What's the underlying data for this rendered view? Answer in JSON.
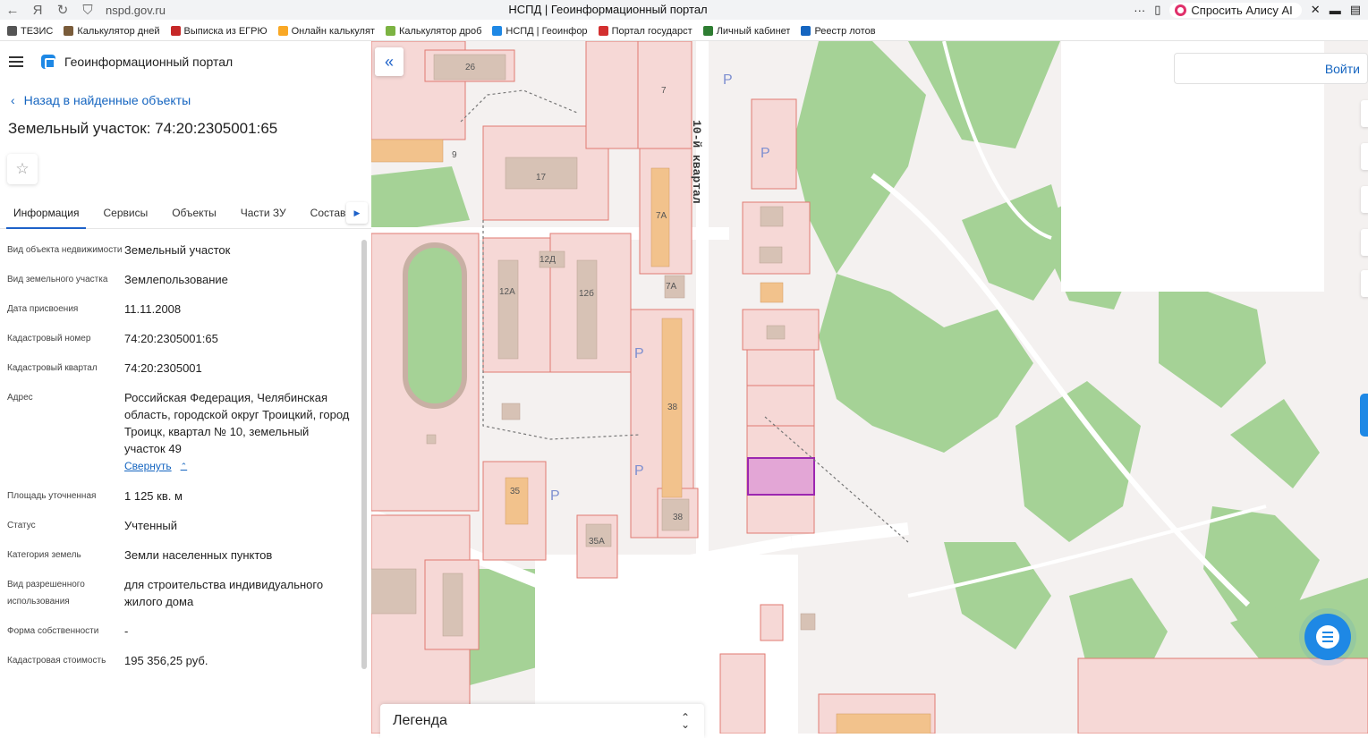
{
  "browser": {
    "url": "nspd.gov.ru",
    "page_title": "НСПД | Геоинформационный портал",
    "more": "···",
    "alice_label": "Спросить Алису AI",
    "bookmarks": [
      {
        "label": "ТЕЗИС",
        "color": "#555555"
      },
      {
        "label": "Калькулятор дней",
        "color": "#7a5c3a"
      },
      {
        "label": "Выписка из ЕГРЮ",
        "color": "#c62828"
      },
      {
        "label": "Онлайн калькулят",
        "color": "#f9a825"
      },
      {
        "label": "Калькулятор дроб",
        "color": "#7cb342"
      },
      {
        "label": "НСПД | Геоинфор",
        "color": "#1e88e5"
      },
      {
        "label": "Портал государст",
        "color": "#d32f2f"
      },
      {
        "label": "Личный кабинет",
        "color": "#2e7d32"
      },
      {
        "label": "Реестр лотов",
        "color": "#1565c0"
      }
    ]
  },
  "portal": {
    "name": "Геоинформационный портал",
    "back_link": "Назад в найденные объекты",
    "title": "Земельный участок: 74:20:2305001:65",
    "tabs": [
      "Информация",
      "Сервисы",
      "Объекты",
      "Части ЗУ",
      "Состав"
    ],
    "active_tab": "Информация"
  },
  "properties": [
    {
      "label": "Вид объекта недвижимости",
      "value": "Земельный участок"
    },
    {
      "label": "Вид земельного участка",
      "value": "Землепользование"
    },
    {
      "label": "Дата присвоения",
      "value": "11.11.2008"
    },
    {
      "label": "Кадастровый номер",
      "value": "74:20:2305001:65"
    },
    {
      "label": "Кадастровый квартал",
      "value": "74:20:2305001"
    },
    {
      "label": "Адрес",
      "value": "Российская Федерация, Челябинская область, городской округ Троицкий, город Троицк, квартал № 10, земельный участок 49"
    },
    {
      "label": "Площадь уточненная",
      "value": "1 125 кв. м"
    },
    {
      "label": "Статус",
      "value": "Учтенный"
    },
    {
      "label": "Категория земель",
      "value": "Земли населенных пунктов"
    },
    {
      "label": "Вид разрешенного использования",
      "value": "для строительства индивидуального жилого дома"
    },
    {
      "label": "Форма собственности",
      "value": "-"
    },
    {
      "label": "Кадастровая стоимость",
      "value": "195 356,25 руб."
    }
  ],
  "collapse_label": "Свернуть",
  "map": {
    "street_label": "10-й квартал",
    "building_numbers": [
      "26",
      "7",
      "9",
      "17",
      "7А",
      "12Д",
      "12А",
      "12б",
      "7А",
      "38",
      "35",
      "38",
      "35А"
    ],
    "parking_label": "P",
    "login_label": "Войти",
    "legend_label": "Легенда",
    "colors": {
      "parcel_fill": "#f6d8d6",
      "parcel_line": "#e07a72",
      "forest": "#9fd08f",
      "road": "#ffffff",
      "building": "#d7c2b5",
      "highlight": "#e3a6d6",
      "highlight_line": "#9c27b0"
    }
  }
}
